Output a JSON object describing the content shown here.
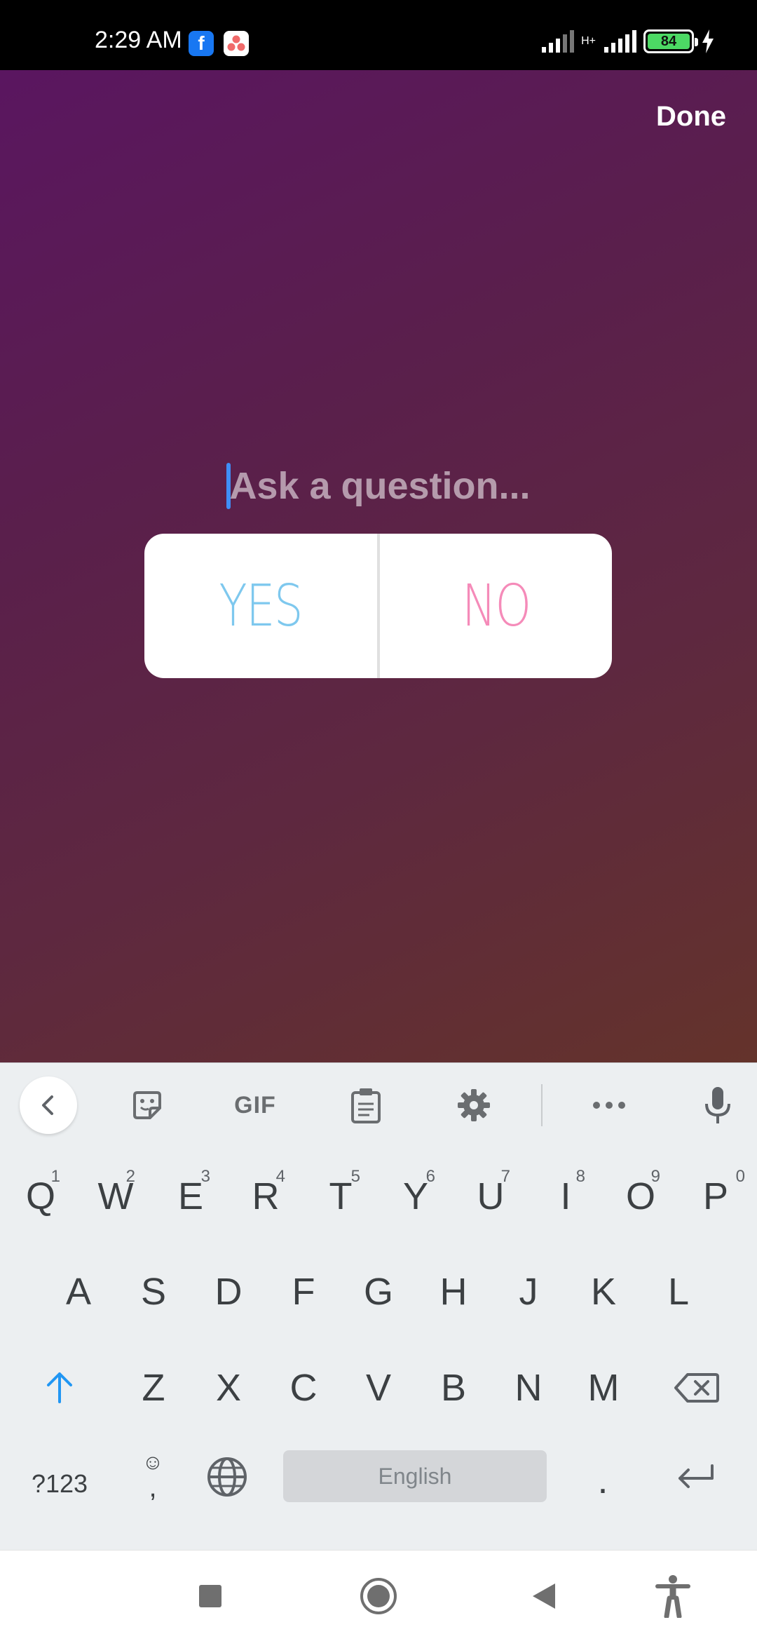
{
  "status_bar": {
    "time": "2:29 AM",
    "facebook_icon_letter": "f",
    "network_type": "H+",
    "battery_level": "84",
    "icons": [
      "facebook-icon",
      "asana-icon",
      "signal-icon",
      "signal-icon",
      "battery-icon",
      "charging-icon"
    ]
  },
  "story": {
    "done_label": "Done",
    "question_placeholder": "Ask a question...",
    "poll_yes": "YES",
    "poll_no": "NO",
    "colors": {
      "gradient_start": "#5a1660",
      "gradient_end": "#64332b",
      "yes_color": "#7ec8ee",
      "no_color": "#f58bb9",
      "cursor_color": "#3f8ff7"
    }
  },
  "keyboard": {
    "toolbar": {
      "gif_label": "GIF",
      "icons": [
        "chevron-left-icon",
        "sticker-icon",
        "gif-icon",
        "clipboard-icon",
        "gear-icon",
        "more-icon",
        "microphone-icon"
      ]
    },
    "row1": [
      {
        "key": "Q",
        "num": "1"
      },
      {
        "key": "W",
        "num": "2"
      },
      {
        "key": "E",
        "num": "3"
      },
      {
        "key": "R",
        "num": "4"
      },
      {
        "key": "T",
        "num": "5"
      },
      {
        "key": "Y",
        "num": "6"
      },
      {
        "key": "U",
        "num": "7"
      },
      {
        "key": "I",
        "num": "8"
      },
      {
        "key": "O",
        "num": "9"
      },
      {
        "key": "P",
        "num": "0"
      }
    ],
    "row2": [
      "A",
      "S",
      "D",
      "F",
      "G",
      "H",
      "J",
      "K",
      "L"
    ],
    "row3": [
      "Z",
      "X",
      "C",
      "V",
      "B",
      "N",
      "M"
    ],
    "bottom": {
      "symbols_label": "?123",
      "emoji_glyph": "☺",
      "comma_glyph": ",",
      "space_label": "English",
      "period_label": "."
    },
    "accent_color": "#2196f3"
  },
  "nav_bar": {
    "icons": [
      "recent-apps-icon",
      "home-icon",
      "back-icon",
      "accessibility-icon"
    ]
  }
}
